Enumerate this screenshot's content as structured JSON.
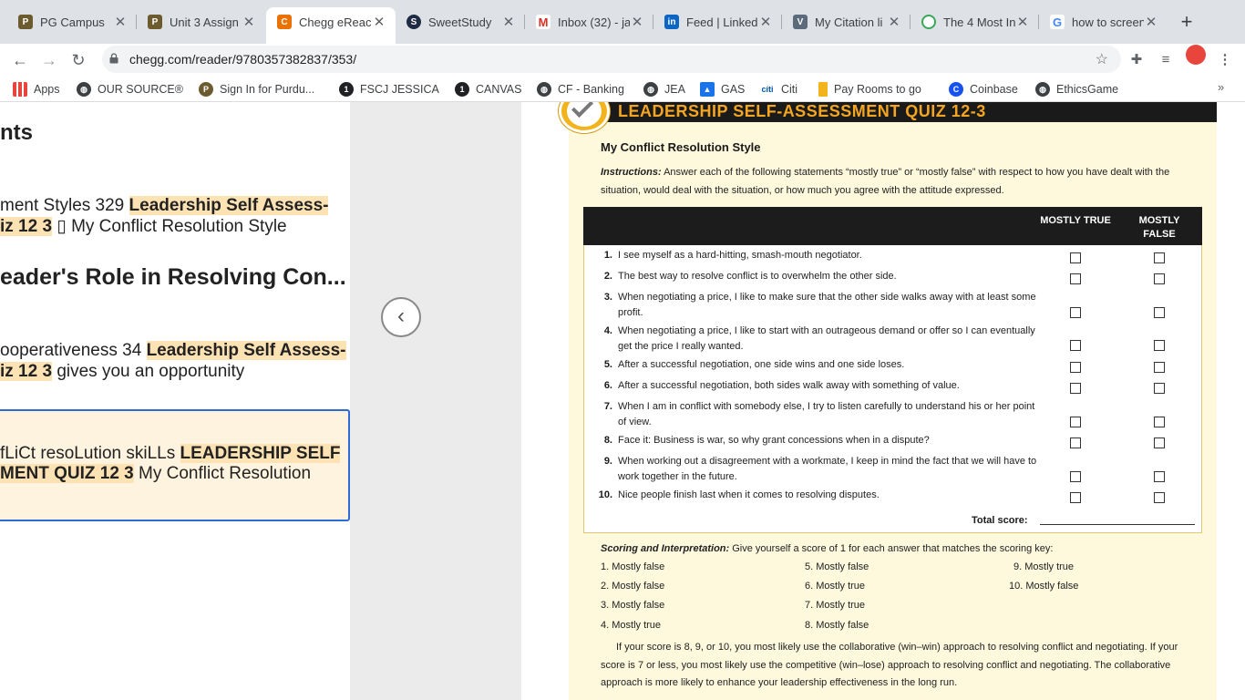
{
  "browser": {
    "tabs": [
      {
        "title": "PG Campus",
        "icon": "pg-campus-icon",
        "color": "#6b5b2e"
      },
      {
        "title": "Unit 3 Assign",
        "icon": "purdue-icon",
        "color": "#6b5b2e"
      },
      {
        "title": "Chegg eReac",
        "icon": "chegg-icon",
        "color": "#eb7100",
        "active": true
      },
      {
        "title": "SweetStudy",
        "icon": "sweetstudy-icon",
        "color": "#1f2a44"
      },
      {
        "title": "Inbox (32) - ja",
        "icon": "gmail-icon",
        "color": "#d93025"
      },
      {
        "title": "Feed | Linked",
        "icon": "linkedin-icon",
        "color": "#0a66c2"
      },
      {
        "title": "My Citation li",
        "icon": "citation-icon",
        "color": "#5b6b7b"
      },
      {
        "title": "The 4 Most In",
        "icon": "timer-icon",
        "color": "#3aa757"
      },
      {
        "title": "how to screen",
        "icon": "google-icon",
        "color": "#4285f4"
      }
    ],
    "url": "chegg.com/reader/9780357382837/353/",
    "bookmarks": [
      {
        "label": "Apps",
        "icon": "apps-grid-icon",
        "color": "#e8453c"
      },
      {
        "label": "OUR SOURCE®",
        "icon": "globe-icon",
        "color": "#3c4043"
      },
      {
        "label": "Sign In for Purdu...",
        "icon": "purdue-icon",
        "color": "#6b5b2e"
      },
      {
        "label": "FSCJ JESSICA",
        "icon": "canvas-icon",
        "color": "#202124"
      },
      {
        "label": "CANVAS",
        "icon": "canvas-icon",
        "color": "#202124"
      },
      {
        "label": "CF - Banking",
        "icon": "globe-icon",
        "color": "#3c4043"
      },
      {
        "label": "JEA",
        "icon": "globe-icon",
        "color": "#3c4043"
      },
      {
        "label": "GAS",
        "icon": "gas-icon",
        "color": "#1a73e8"
      },
      {
        "label": "Citi",
        "icon": "citi-icon",
        "color": "#0056a4"
      },
      {
        "label": "Pay Rooms to go",
        "icon": "rooms-to-go-icon",
        "color": "#f2b31c"
      },
      {
        "label": "Coinbase",
        "icon": "coinbase-icon",
        "color": "#1652f0"
      },
      {
        "label": "EthicsGame",
        "icon": "globe-icon",
        "color": "#3c4043"
      }
    ],
    "bookmarks_more": "»"
  },
  "left_pane": {
    "heading": "nts",
    "results": [
      {
        "pre": "ment Styles 329 ",
        "hl1": "Leadership Self Assess-",
        "hl2": "iz 12 3",
        "post": " My Conflict Resolution Style",
        "glyph": "▯"
      },
      {
        "heading": "eader's Role in Resolving Con..."
      },
      {
        "pre": "ooperativeness 34 ",
        "hl1": "Leadership Self Assess-",
        "hl2": "iz 12 3",
        "post": " gives you an opportunity"
      },
      {
        "pre": "fLiCt resoLution skiLLs ",
        "hl1": "LEADERSHIP SELF",
        "hl2": "MENT QUIZ 12 3",
        "post": " My Conflict Resolution"
      }
    ],
    "prev_button": "‹"
  },
  "quiz": {
    "title": "LEADERSHIP SELF-ASSESSMENT QUIZ 12-3",
    "subtitle": "My Conflict Resolution Style",
    "instructions_label": "Instructions:",
    "instructions": " Answer each of the following statements “mostly true” or “mostly false” with respect to how you have dealt with the situation, would deal with the situation, or how much you agree with the attitude expressed.",
    "col_true": "MOSTLY TRUE",
    "col_false": "MOSTLY FALSE",
    "questions": [
      {
        "n": "1.",
        "text": "I see myself as a hard-hitting, smash-mouth negotiator."
      },
      {
        "n": "2.",
        "text": "The best way to resolve conflict is to overwhelm the other side."
      },
      {
        "n": "3.",
        "text": "When negotiating a price, I like to make sure that the other side walks away with at least some profit."
      },
      {
        "n": "4.",
        "text": "When negotiating a price, I like to start with an outrageous demand or offer so I can eventually get the price I really wanted."
      },
      {
        "n": "5.",
        "text": "After a successful negotiation, one side wins and one side loses."
      },
      {
        "n": "6.",
        "text": "After a successful negotiation, both sides walk away with something of value."
      },
      {
        "n": "7.",
        "text": "When I am in conflict with somebody else, I try to listen carefully to understand his or her point of view."
      },
      {
        "n": "8.",
        "text": "Face it: Business is war, so why grant concessions when in a dispute?"
      },
      {
        "n": "9.",
        "text": "When working out a disagreement with a workmate, I keep in mind the fact that we will have to work together in the future."
      },
      {
        "n": "10.",
        "text": "Nice people finish last when it comes to resolving disputes."
      }
    ],
    "total_label": "Total score:",
    "scoring_label": "Scoring and Interpretation:",
    "scoring_text": " Give yourself a score of 1 for each answer that matches the scoring key:",
    "key": [
      "1.  Mostly false",
      "2.  Mostly false",
      "3.  Mostly false",
      "4.  Mostly true",
      "5.  Mostly false",
      "6.  Mostly true",
      "7.  Mostly true",
      "8.  Mostly false",
      "9.  Mostly true",
      "10.  Mostly false"
    ],
    "interpretation": "If your score is 8, 9, or 10, you most likely use the collaborative (win–win) approach to resolving conflict and negotiating. If your score is 7 or less, you most likely use the competitive (win–lose) approach to resolving conflict and negotiating. The collaborative approach is more likely to enhance your leadership effectiveness in the long run."
  }
}
